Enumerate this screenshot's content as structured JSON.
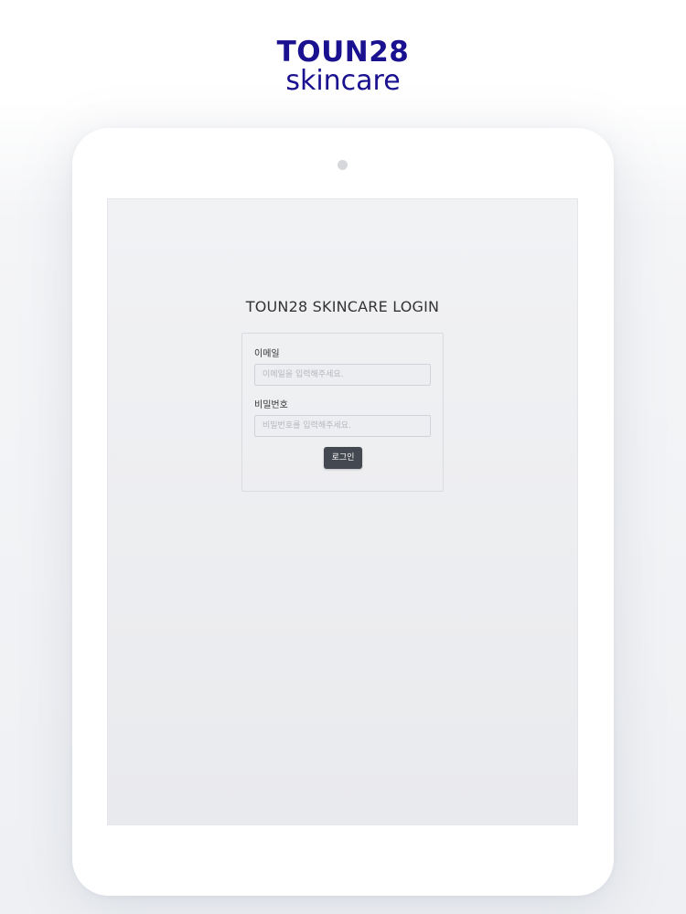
{
  "brand": {
    "title": "TOUN28",
    "subtitle": "skincare"
  },
  "login": {
    "heading": "TOUN28 SKINCARE LOGIN",
    "email_label": "이메일",
    "email_placeholder": "이메일을 입력해주세요.",
    "email_value": "",
    "password_label": "비밀번호",
    "password_placeholder": "비밀번호를 입력해주세요.",
    "password_value": "",
    "submit_label": "로그인"
  },
  "colors": {
    "brand": "#1a1190",
    "button": "#444850"
  }
}
